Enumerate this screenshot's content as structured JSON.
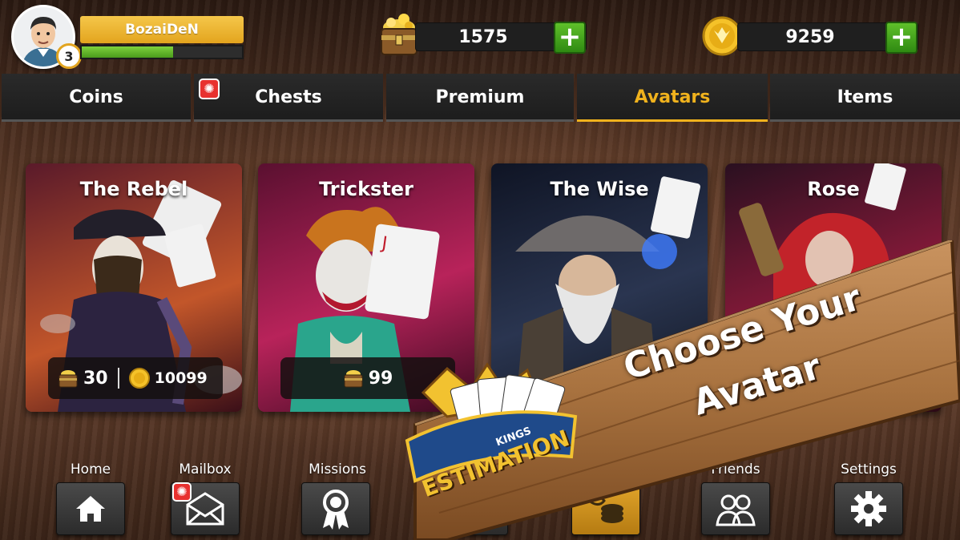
{
  "player": {
    "name": "BozaiDeN",
    "level": "3",
    "xp_fraction": 0.57
  },
  "resources": {
    "chests": {
      "value": "1575",
      "icon": "treasure-chest-icon",
      "add_label": "+"
    },
    "coins": {
      "value": "9259",
      "icon": "gold-coin-icon",
      "add_label": "+"
    }
  },
  "tabs": [
    {
      "label": "Coins",
      "active": false
    },
    {
      "label": "Chests",
      "active": false,
      "badge": true
    },
    {
      "label": "Premium",
      "active": false
    },
    {
      "label": "Avatars",
      "active": true
    },
    {
      "label": "Items",
      "active": false
    }
  ],
  "avatars": [
    {
      "title": "The Rebel",
      "chest_price": "30",
      "coin_price": "10099"
    },
    {
      "title": "Trickster",
      "chest_price": "99"
    },
    {
      "title": "The Wise"
    },
    {
      "title": "Rose"
    }
  ],
  "nav": [
    {
      "label": "Home",
      "icon": "home-icon"
    },
    {
      "label": "Mailbox",
      "icon": "mail-icon",
      "badge": true
    },
    {
      "label": "Missions",
      "icon": "ribbon-icon"
    },
    {
      "label": "",
      "icon": "cards-icon"
    },
    {
      "label": "",
      "icon": "coin-stack-icon",
      "active": true
    },
    {
      "label": "Friends",
      "icon": "friends-icon"
    },
    {
      "label": "Settings",
      "icon": "gear-icon"
    }
  ],
  "promo": {
    "line1": "Choose Your",
    "line2": "Avatar",
    "logo_text": "ESTIMATION",
    "logo_sub": "KINGS"
  },
  "colors": {
    "accent": "#f0b21d",
    "plus_green": "#4aa81f",
    "badge_red": "#e8312f",
    "tab_bg": "#222222"
  }
}
